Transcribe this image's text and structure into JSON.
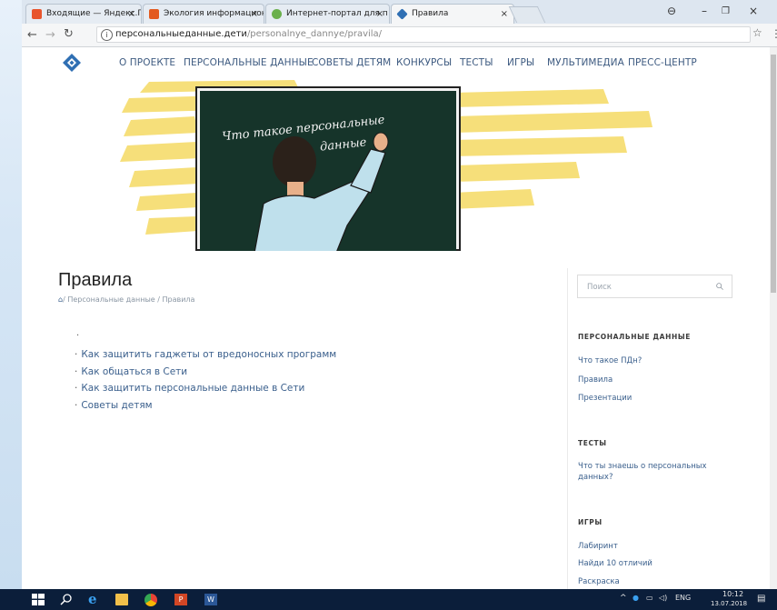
{
  "browser": {
    "tabs": [
      {
        "label": "Входящие — Яндекс.По",
        "color": "#e8552d"
      },
      {
        "label": "Экология информацион",
        "color": "#e35a1f"
      },
      {
        "label": "Интернет-портал для п",
        "color": "#6ab04c"
      },
      {
        "label": "Правила",
        "color": "#2f6fb3"
      }
    ],
    "tab_close": "×",
    "controls": {
      "account": "⊖",
      "minimize": "–",
      "restore": "❐",
      "close": "×"
    },
    "address_host": "персональныеданные.дети",
    "address_path": "/personalnye_dannye/pravila/",
    "address_info": "i"
  },
  "nav": {
    "items": [
      "О ПРОЕКТЕ",
      "ПЕРСОНАЛЬНЫЕ ДАННЫЕ",
      "СОВЕТЫ ДЕТЯМ",
      "КОНКУРСЫ",
      "ТЕСТЫ",
      "ИГРЫ",
      "МУЛЬТИМЕДИА",
      "ПРЕСС-ЦЕНТР"
    ]
  },
  "hero": {
    "board_line1": "Что такое персональные",
    "board_line2": "данные"
  },
  "page": {
    "title": "Правила",
    "breadcrumb": "/ Персональные данные / Правила",
    "lone_bullet": "·",
    "links": [
      "Как защитить гаджеты от вредоносных программ",
      "Как общаться в Сети",
      "Как защитить персональные данные в Сети",
      "Советы детям"
    ]
  },
  "sidebar": {
    "search_placeholder": "Поиск",
    "sections": [
      {
        "heading": "ПЕРСОНАЛЬНЫЕ ДАННЫЕ",
        "links": [
          "Что такое ПДн?",
          "Правила",
          "Презентации"
        ]
      },
      {
        "heading": "ТЕСТЫ",
        "links": [
          "Что ты знаешь о персональных данных?"
        ]
      },
      {
        "heading": "ИГРЫ",
        "links": [
          "Лабиринт",
          "Найди 10 отличий",
          "Раскраска"
        ]
      }
    ]
  },
  "taskbar": {
    "lang": "ENG",
    "time": "10:12",
    "date": "13.07.2018"
  },
  "colors": {
    "accent": "#3a5f8c",
    "hero_yellow": "#f6df7a",
    "board": "#16342a",
    "taskbar": "#0b1e3a"
  }
}
